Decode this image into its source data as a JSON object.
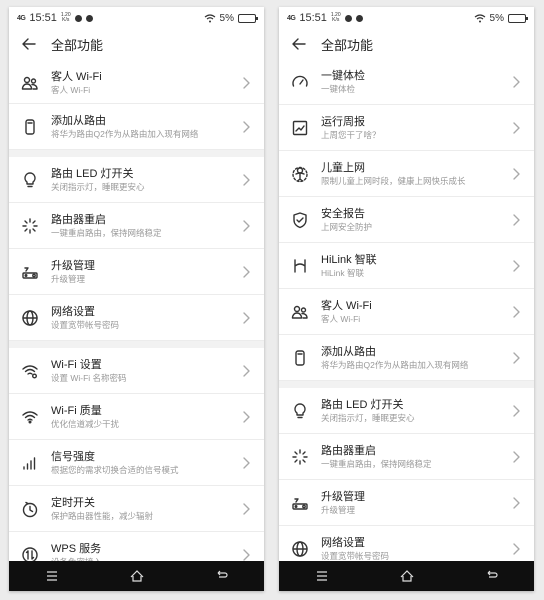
{
  "status": {
    "signal": "4G",
    "time": "15:51",
    "speed_top": "1.20",
    "speed_bottom": "K/s",
    "battery": "5%"
  },
  "header": {
    "title": "全部功能"
  },
  "left_items": [
    {
      "icon": "guest-wifi-icon",
      "title": "客人 Wi-Fi",
      "sub": "客人 Wi-Fi"
    },
    {
      "icon": "secondary-router-icon",
      "title": "添加从路由",
      "sub": "将华为路由Q2作为从路由加入现有网络"
    },
    {
      "icon": "bulb-icon",
      "title": "路由 LED 灯开关",
      "sub": "关闭指示灯，睡眠更安心"
    },
    {
      "icon": "restart-icon",
      "title": "路由器重启",
      "sub": "一键重启路由，保持网络稳定"
    },
    {
      "icon": "upgrade-icon",
      "title": "升级管理",
      "sub": "升级管理"
    },
    {
      "icon": "globe-icon",
      "title": "网络设置",
      "sub": "设置宽带帐号密码"
    },
    {
      "icon": "wifi-settings-icon",
      "title": "Wi-Fi 设置",
      "sub": "设置 Wi-Fi 名称密码"
    },
    {
      "icon": "wifi-quality-icon",
      "title": "Wi-Fi 质量",
      "sub": "优化信道减少干扰"
    },
    {
      "icon": "signal-strength-icon",
      "title": "信号强度",
      "sub": "根据您的需求切换合适的信号模式"
    },
    {
      "icon": "timer-icon",
      "title": "定时开关",
      "sub": "保护路由器性能，减少辐射"
    },
    {
      "icon": "wps-icon",
      "title": "WPS 服务",
      "sub": "设备免密接入"
    }
  ],
  "right_items": [
    {
      "icon": "speedometer-icon",
      "title": "一键体检",
      "sub": "一键体检"
    },
    {
      "icon": "weekly-report-icon",
      "title": "运行周报",
      "sub": "上周您干了啥？"
    },
    {
      "icon": "child-icon",
      "title": "儿童上网",
      "sub": "限制儿童上网时段，健康上网快乐成长"
    },
    {
      "icon": "shield-icon",
      "title": "安全报告",
      "sub": "上网安全防护"
    },
    {
      "icon": "hilink-icon",
      "title": "HiLink 智联",
      "sub": "HiLink 智联"
    },
    {
      "icon": "guest-wifi-icon",
      "title": "客人 Wi-Fi",
      "sub": "客人 Wi-Fi"
    },
    {
      "icon": "secondary-router-icon",
      "title": "添加从路由",
      "sub": "将华为路由Q2作为从路由加入现有网络"
    },
    {
      "icon": "bulb-icon",
      "title": "路由 LED 灯开关",
      "sub": "关闭指示灯，睡眠更安心"
    },
    {
      "icon": "restart-icon",
      "title": "路由器重启",
      "sub": "一键重启路由，保持网络稳定"
    },
    {
      "icon": "upgrade-icon",
      "title": "升级管理",
      "sub": "升级管理"
    },
    {
      "icon": "globe-icon",
      "title": "网络设置",
      "sub": "设置宽带帐号密码"
    }
  ],
  "nav": {
    "menu": "menu-icon",
    "home": "home-icon",
    "back": "back-nav-icon"
  }
}
